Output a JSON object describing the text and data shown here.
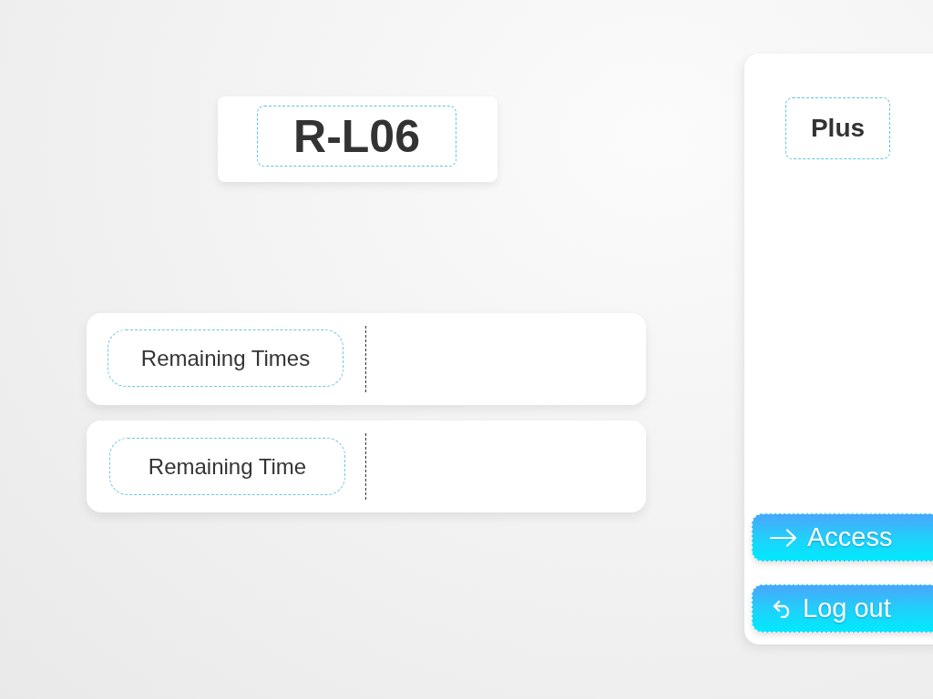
{
  "title_card": {
    "code": "R-L06"
  },
  "info_rows": [
    {
      "label": "Remaining Times"
    },
    {
      "label": "Remaining Time"
    }
  ],
  "side_panel": {
    "plan": "Plus",
    "buttons": [
      {
        "kind": "enter",
        "label": "Access"
      },
      {
        "kind": "logout",
        "label": "Log out"
      }
    ]
  }
}
